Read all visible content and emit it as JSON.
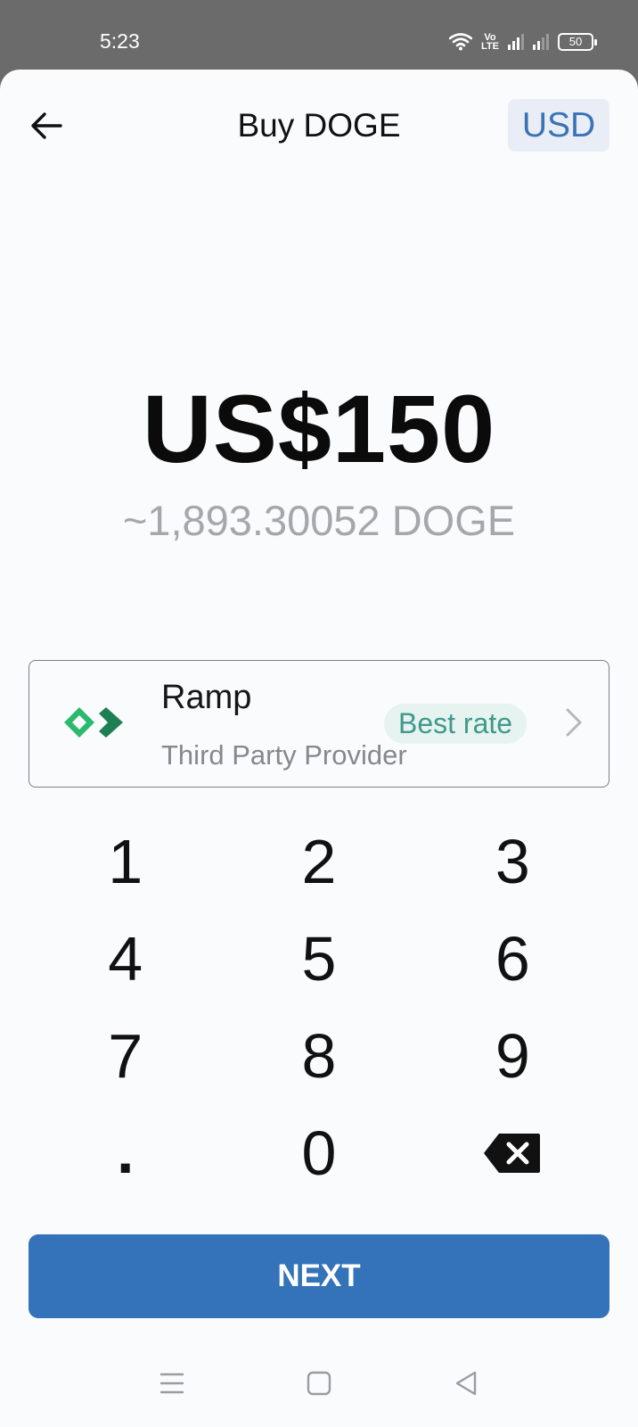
{
  "status_bar": {
    "time": "5:23",
    "volte_label": "Vo\nLTE",
    "battery_level": "50"
  },
  "header": {
    "title": "Buy DOGE",
    "currency_toggle": "USD"
  },
  "amount": {
    "fiat_display": "US$150",
    "crypto_estimate": "~1,893.30052 DOGE"
  },
  "provider": {
    "name": "Ramp",
    "subtitle": "Third Party Provider",
    "badge": "Best rate",
    "logo_colors": [
      "#2cb96f",
      "#1e7f55"
    ]
  },
  "keypad": {
    "keys": [
      "1",
      "2",
      "3",
      "4",
      "5",
      "6",
      "7",
      "8",
      "9",
      ".",
      "0"
    ],
    "backspace_icon": "backspace-icon"
  },
  "next_button": {
    "label": "NEXT"
  },
  "nav_bar": {
    "icons": [
      "menu-icon",
      "home-square-icon",
      "back-triangle-icon"
    ]
  },
  "colors": {
    "accent": "#3473b9",
    "badge_bg": "#e7f3f0",
    "badge_text": "#3e9a8b"
  }
}
